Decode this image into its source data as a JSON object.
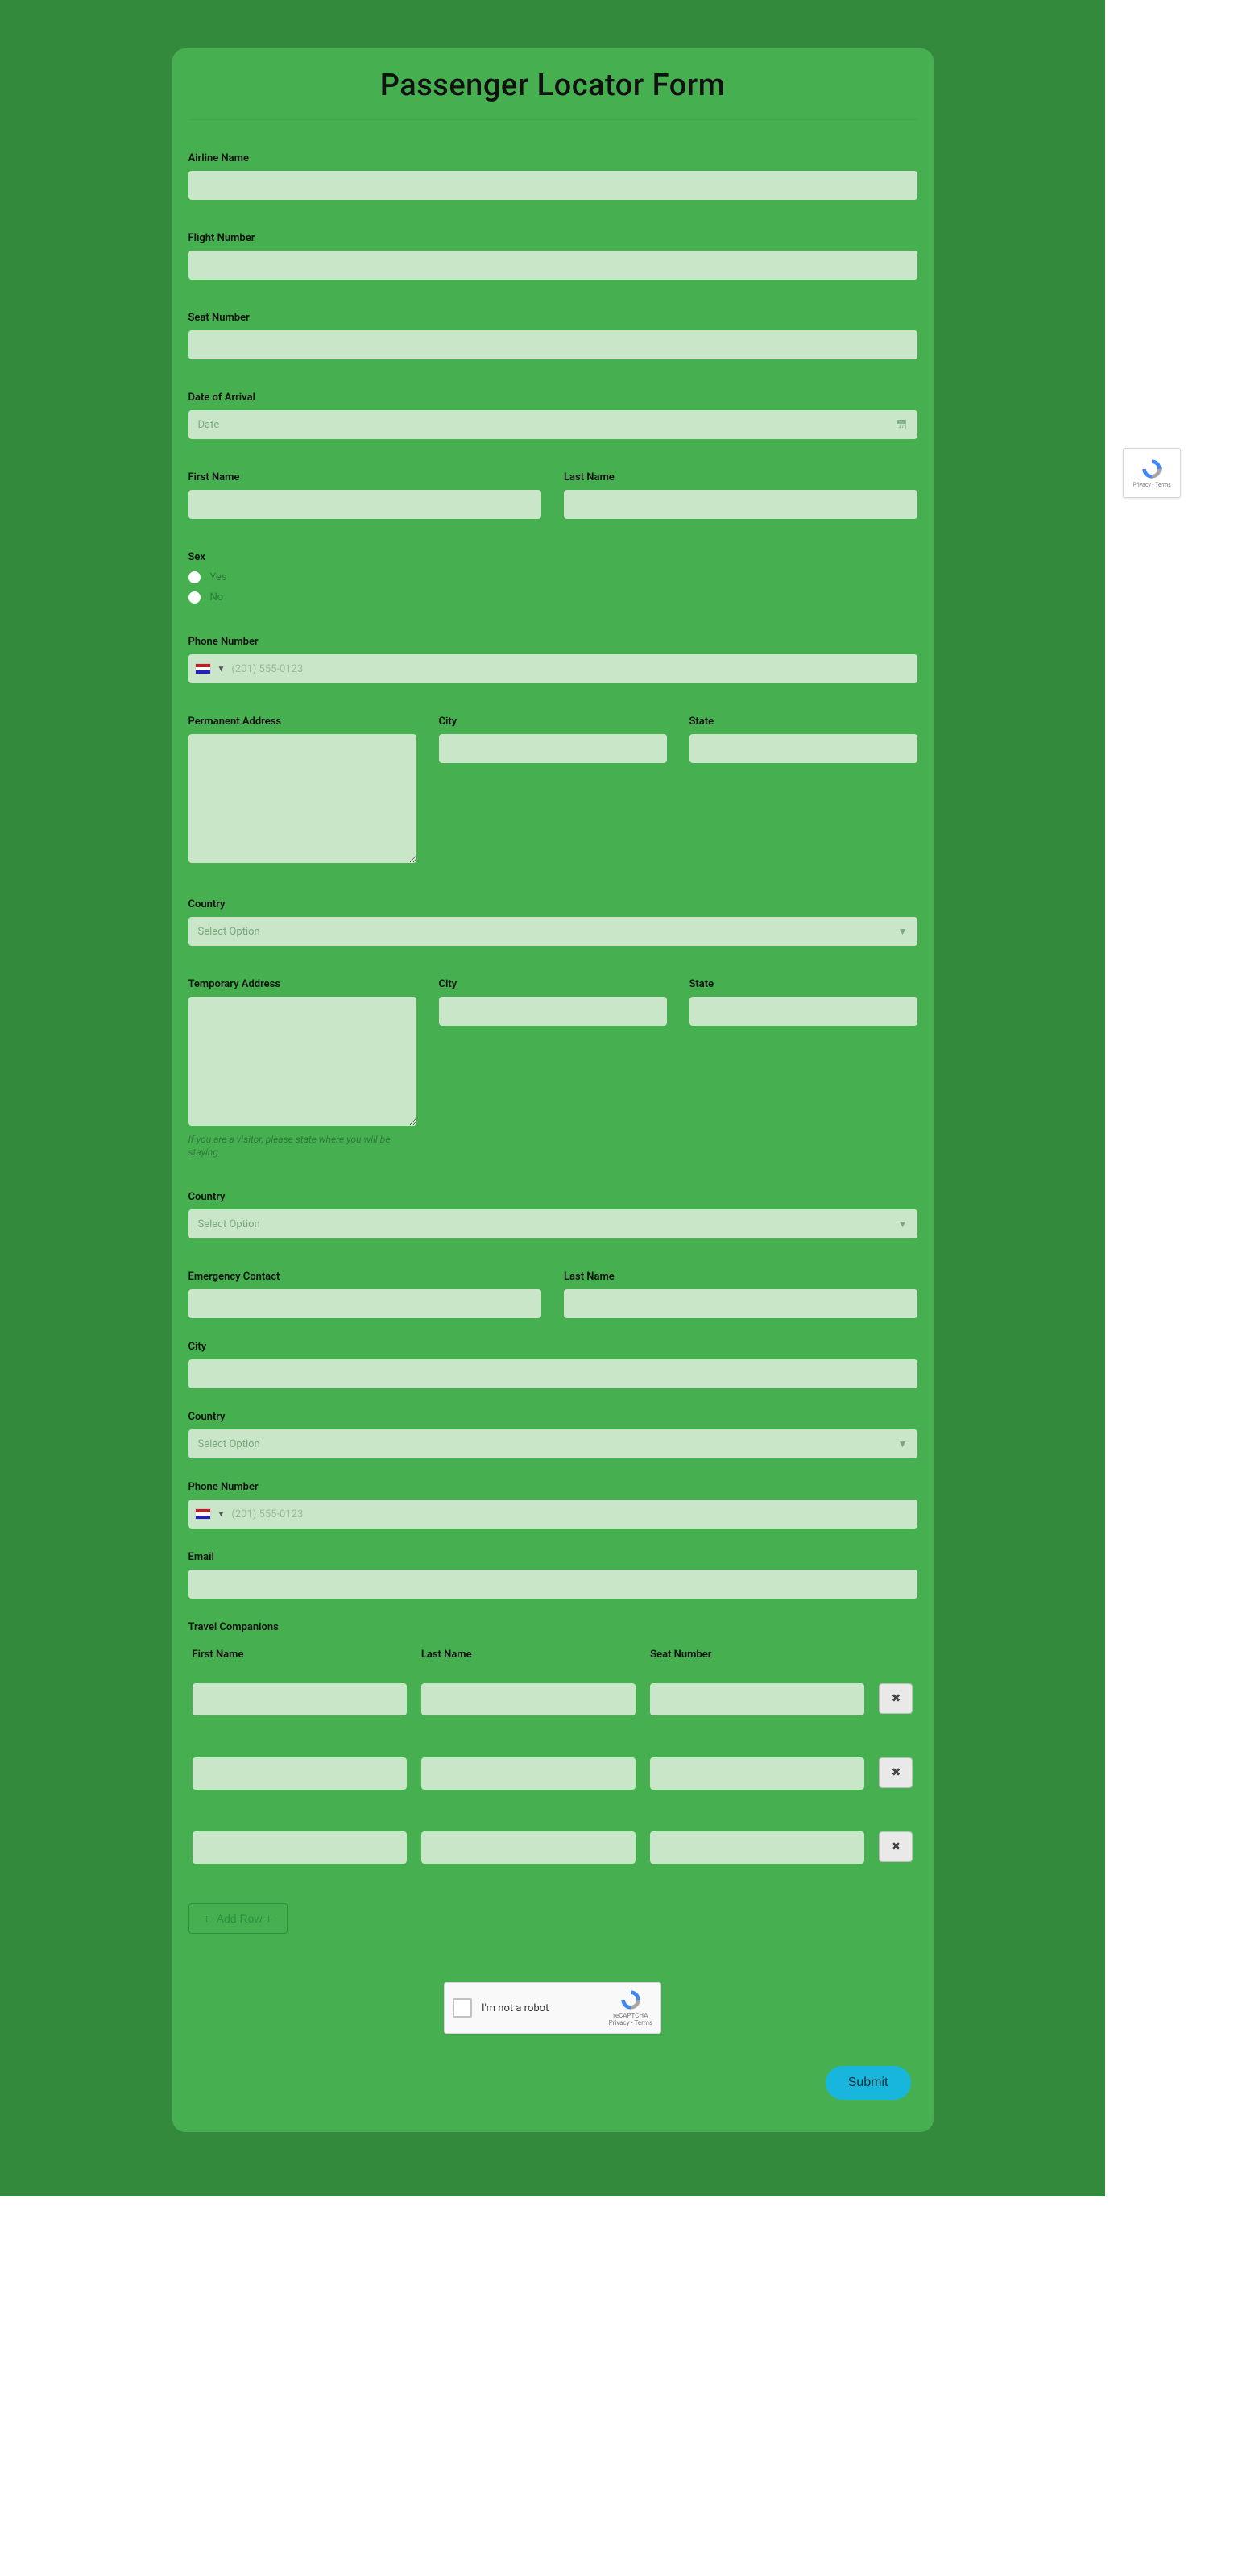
{
  "title": "Passenger Locator Form",
  "fields": {
    "airline_name": {
      "label": "Airline Name",
      "value": ""
    },
    "flight_number": {
      "label": "Flight Number",
      "value": ""
    },
    "seat_number": {
      "label": "Seat Number",
      "value": ""
    },
    "date_of_arrival": {
      "label": "Date of Arrival",
      "placeholder": "Date"
    },
    "first_name": {
      "label": "First Name",
      "value": ""
    },
    "last_name": {
      "label": "Last Name",
      "value": ""
    },
    "sex": {
      "label": "Sex",
      "options": [
        "Yes",
        "No"
      ]
    },
    "phone1": {
      "label": "Phone Number",
      "placeholder": "(201) 555-0123"
    },
    "perm_address": {
      "label": "Permanent Address",
      "value": ""
    },
    "perm_city": {
      "label": "City",
      "value": ""
    },
    "perm_state": {
      "label": "State",
      "value": ""
    },
    "perm_country": {
      "label": "Country",
      "placeholder": "Select Option"
    },
    "temp_address": {
      "label": "Temporary Address",
      "value": "",
      "hint": "If you are a visitor, please state where you will be staying"
    },
    "temp_city": {
      "label": "City",
      "value": ""
    },
    "temp_state": {
      "label": "State",
      "value": ""
    },
    "temp_country": {
      "label": "Country",
      "placeholder": "Select Option"
    },
    "emergency_contact": {
      "label": "Emergency Contact",
      "value": ""
    },
    "emergency_last_name": {
      "label": "Last Name",
      "value": ""
    },
    "emergency_city": {
      "label": "City",
      "value": ""
    },
    "emergency_country": {
      "label": "Country",
      "placeholder": "Select Option"
    },
    "phone2": {
      "label": "Phone Number",
      "placeholder": "(201) 555-0123"
    },
    "email": {
      "label": "Email",
      "value": ""
    }
  },
  "companions": {
    "label": "Travel Companions",
    "headers": {
      "first": "First Name",
      "last": "Last Name",
      "seat": "Seat Number"
    },
    "rows": [
      {
        "first": "",
        "last": "",
        "seat": ""
      },
      {
        "first": "",
        "last": "",
        "seat": ""
      },
      {
        "first": "",
        "last": "",
        "seat": ""
      }
    ],
    "add_label": "Add Row +"
  },
  "recaptcha": {
    "text": "I'm not a robot",
    "brand": "reCAPTCHA",
    "legal": "Privacy - Terms"
  },
  "submit_label": "Submit"
}
